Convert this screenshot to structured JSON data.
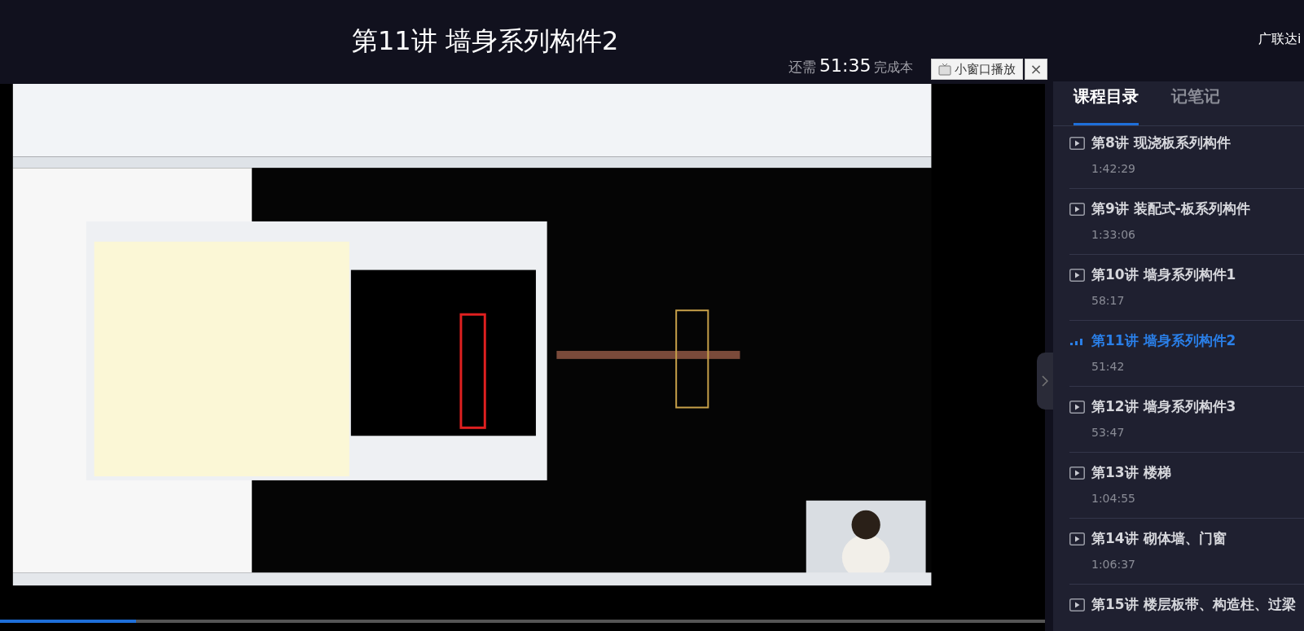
{
  "header": {
    "title": "第11讲 墙身系列构件2",
    "brand": "广联达i",
    "remaining_label": "还需",
    "remaining_time": "51:35",
    "remaining_suffix": "完成本",
    "mini_player_button": "小窗口播放",
    "close_button": "×"
  },
  "video": {
    "kind": "picture",
    "progress": {
      "level": 0.13
    }
  },
  "sidebar": {
    "tabs": [
      {
        "label": "课程目录",
        "selected": true
      },
      {
        "label": "记笔记",
        "selected": false
      }
    ],
    "lessons": [
      {
        "title": "第8讲 现浇板系列构件",
        "duration": "1:42:29",
        "selected": false
      },
      {
        "title": "第9讲 装配式-板系列构件",
        "duration": "1:33:06",
        "selected": false
      },
      {
        "title": "第10讲 墙身系列构件1",
        "duration": "58:17",
        "selected": false
      },
      {
        "title": "第11讲 墙身系列构件2",
        "duration": "51:42",
        "selected": true
      },
      {
        "title": "第12讲 墙身系列构件3",
        "duration": "53:47",
        "selected": false
      },
      {
        "title": "第13讲 楼梯",
        "duration": "1:04:55",
        "selected": false
      },
      {
        "title": "第14讲 砌体墙、门窗",
        "duration": "1:06:37",
        "selected": false
      },
      {
        "title": "第15讲 楼层板带、构造柱、过梁",
        "selected": false
      }
    ]
  }
}
